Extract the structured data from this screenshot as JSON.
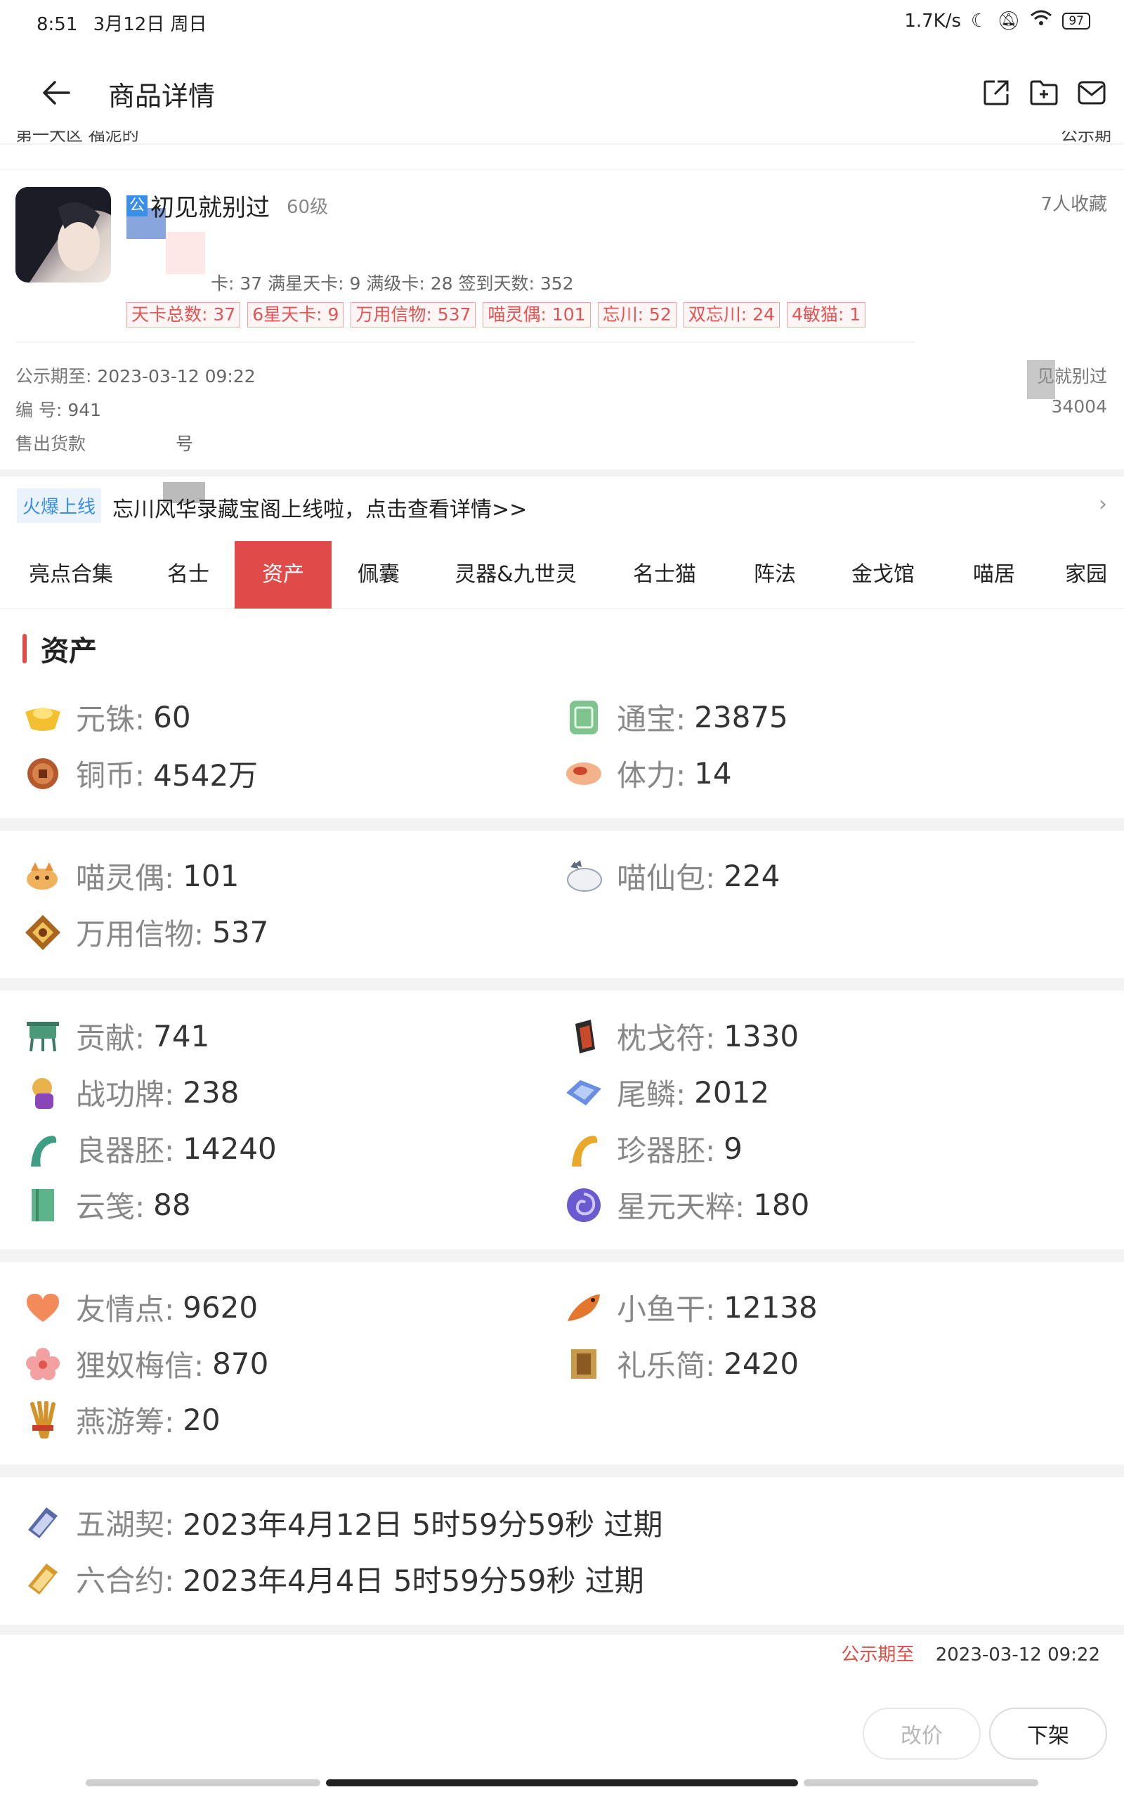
{
  "status_bar": {
    "time": "8:51",
    "date": "3月12日 周日",
    "net_speed": "1.7K/s",
    "battery": "97"
  },
  "header": {
    "title": "商品详情"
  },
  "clipped_row": {
    "left": "第一大区 福泥的",
    "right": "公示期"
  },
  "seller": {
    "pub_tag": "公",
    "name": "初见就别过",
    "level": "60级",
    "favorites": "7人收藏"
  },
  "stats_line": "卡: 37 满星天卡: 9 满级卡: 28 签到天数: 352",
  "tags": [
    "天卡总数: 37",
    "6星天卡: 9",
    "万用信物: 537",
    "喵灵偶: 101",
    "忘川: 52",
    "双忘川: 24",
    "4敏猫: 1"
  ],
  "meta": {
    "publicity_label": "公示期至:",
    "publicity_value": "2023-03-12 09:22",
    "serial_label": "编 号:",
    "serial_value": "941",
    "sale_label": "售出货款",
    "sale_value": "号",
    "right_name": "见就别过",
    "right_num": "34004"
  },
  "banner": {
    "hot": "火爆上线",
    "text": "忘川风华录藏宝阁上线啦，点击查看详情>>",
    "chevron": "›"
  },
  "tabs": [
    "亮点合集",
    "名士",
    "资产",
    "佩囊",
    "灵器&九世灵",
    "名士猫",
    "阵法",
    "金戈馆",
    "喵居",
    "家园"
  ],
  "active_tab": "资产",
  "section_title": "资产",
  "groups": [
    [
      {
        "icon": "gold-ingot-icon",
        "key": "元铢:",
        "value": "60"
      },
      {
        "icon": "jade-token-icon",
        "key": "通宝:",
        "value": "23875"
      },
      {
        "icon": "copper-coin-icon",
        "key": "铜币:",
        "value": "4542万"
      },
      {
        "icon": "stamina-bowl-icon",
        "key": "体力:",
        "value": "14"
      }
    ],
    [
      {
        "icon": "cat-doll-icon",
        "key": "喵灵偶:",
        "value": "101"
      },
      {
        "icon": "cat-bun-icon",
        "key": "喵仙包:",
        "value": "224"
      },
      {
        "icon": "token-box-icon",
        "key": "万用信物:",
        "value": "537"
      }
    ],
    [
      {
        "icon": "tribute-vessel-icon",
        "key": "贡献:",
        "value": "741"
      },
      {
        "icon": "talisman-icon",
        "key": "枕戈符:",
        "value": "1330"
      },
      {
        "icon": "merit-medal-icon",
        "key": "战功牌:",
        "value": "238"
      },
      {
        "icon": "tail-scale-icon",
        "key": "尾鳞:",
        "value": "2012"
      },
      {
        "icon": "jade-blank-icon",
        "key": "良器胚:",
        "value": "14240"
      },
      {
        "icon": "gold-blank-icon",
        "key": "珍器胚:",
        "value": "9"
      },
      {
        "icon": "cloud-paper-icon",
        "key": "云笺:",
        "value": "88"
      },
      {
        "icon": "star-swirl-icon",
        "key": "星元天粹:",
        "value": "180"
      }
    ],
    [
      {
        "icon": "heart-icon",
        "key": "友情点:",
        "value": "9620"
      },
      {
        "icon": "dried-fish-icon",
        "key": "小鱼干:",
        "value": "12138"
      },
      {
        "icon": "plum-letter-icon",
        "key": "狸奴梅信:",
        "value": "870"
      },
      {
        "icon": "bamboo-slip-icon",
        "key": "礼乐简:",
        "value": "2420"
      },
      {
        "icon": "tally-sticks-icon",
        "key": "燕游筹:",
        "value": "20"
      }
    ],
    [
      {
        "icon": "pact-scroll-icon",
        "key": "五湖契:",
        "value": "2023年4月12日 5时59分59秒 过期"
      },
      {
        "icon": "contract-scroll-icon",
        "key": "六合约:",
        "value": "2023年4月4日 5时59分59秒 过期"
      }
    ]
  ],
  "footer": {
    "publicity_label": "公示期至",
    "publicity_value": "2023-03-12 09:22",
    "edit_price": "改价",
    "delist": "下架"
  },
  "colors": {
    "accent": "#e04a48",
    "link_blue": "#3a8ee6"
  }
}
